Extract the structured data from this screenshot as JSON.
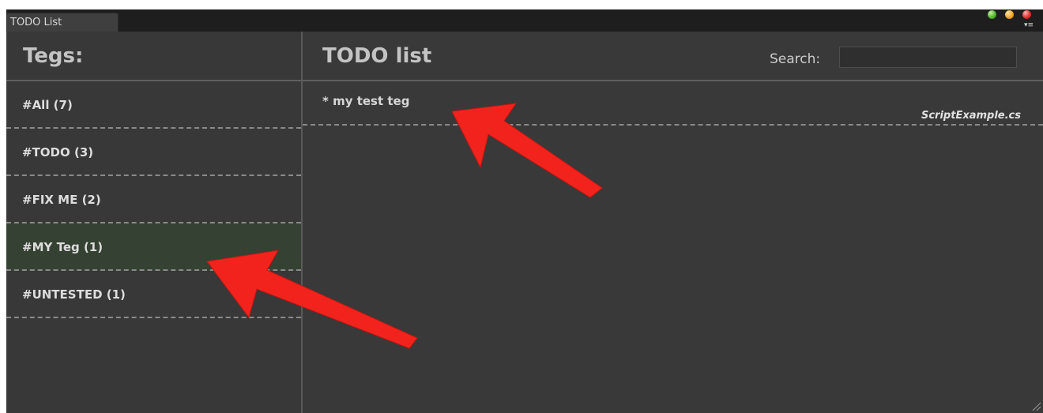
{
  "window": {
    "tab_title": "TODO List"
  },
  "left": {
    "title": "Tegs:",
    "tags": [
      {
        "label": "#All (7)"
      },
      {
        "label": "#TODO (3)"
      },
      {
        "label": "#FIX ME (2)"
      },
      {
        "label": "#MY Teg (1)",
        "selected": true
      },
      {
        "label": "#UNTESTED (1)"
      }
    ]
  },
  "right": {
    "title": "TODO list",
    "search_label": "Search:",
    "search_value": "",
    "items": [
      {
        "text": "* my test teg",
        "file": "ScriptExample.cs"
      }
    ]
  },
  "colors": {
    "background": "#393939",
    "selected_tag": "#354132",
    "annotation_arrow": "#f2231d"
  },
  "icons": [
    "window-minimize-icon",
    "window-maximize-icon",
    "window-close-icon",
    "window-menu-icon",
    "resize-grip-icon",
    "annotation-arrow"
  ]
}
